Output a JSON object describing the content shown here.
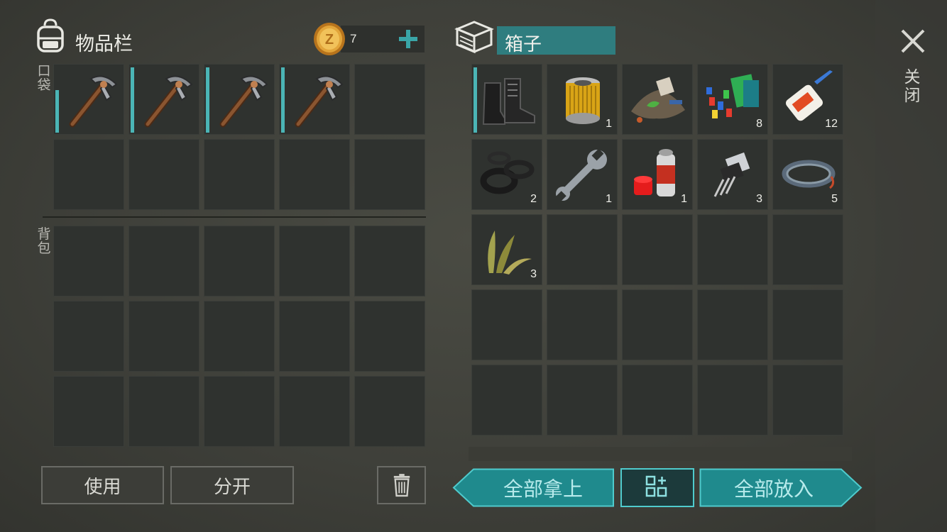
{
  "inventory": {
    "title": "物品栏",
    "coins": "7",
    "pockets_label": "口袋",
    "backpack_label": "背包",
    "pocket_items": [
      {
        "icon": "pickaxe-icon",
        "count": "",
        "durability": 0.65
      },
      {
        "icon": "pickaxe-icon",
        "count": "",
        "durability": 1.0
      },
      {
        "icon": "pickaxe-icon",
        "count": "",
        "durability": 1.0
      },
      {
        "icon": "pickaxe-icon",
        "count": "",
        "durability": 1.0
      }
    ],
    "use_label": "使用",
    "split_label": "分开"
  },
  "container": {
    "title": "箱子",
    "close_label": "关闭",
    "items": [
      {
        "icon": "boots-icon",
        "count": "",
        "durability": 1.0
      },
      {
        "icon": "oil-filter-icon",
        "count": "1"
      },
      {
        "icon": "scrap-pile-icon",
        "count": ""
      },
      {
        "icon": "electronics-parts-icon",
        "count": "8"
      },
      {
        "icon": "super-glue-icon",
        "count": "12"
      },
      {
        "icon": "rubber-seals-icon",
        "count": "2"
      },
      {
        "icon": "wrench-icon",
        "count": "1"
      },
      {
        "icon": "aerosol-paint-icon",
        "count": "1"
      },
      {
        "icon": "transistor-icon",
        "count": "3"
      },
      {
        "icon": "wire-coil-icon",
        "count": "5"
      },
      {
        "icon": "plant-fiber-icon",
        "count": "3"
      }
    ],
    "take_all_label": "全部拿上",
    "put_all_label": "全部放入"
  },
  "colors": {
    "accent": "#2f9c9f",
    "slot": "#2f322f",
    "durability": "#4bb5b6"
  }
}
